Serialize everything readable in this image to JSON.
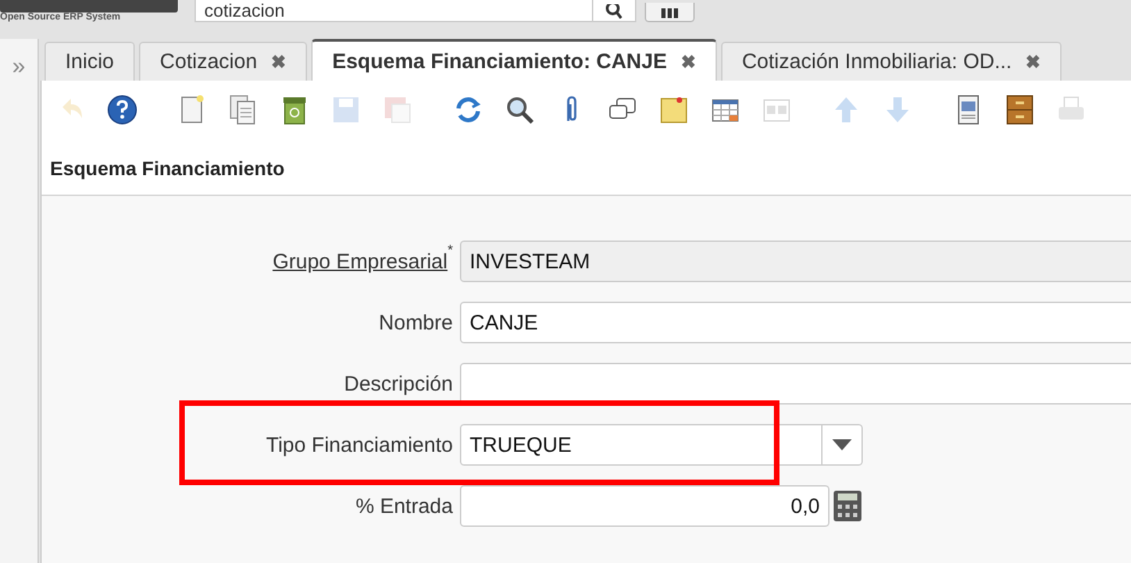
{
  "header": {
    "tagline": "Open Source ERP System",
    "search": {
      "value": "cotizacion"
    }
  },
  "sidebar": {
    "expand_glyph": "»"
  },
  "tabs": [
    {
      "label": "Inicio",
      "selected": false
    },
    {
      "label": "Cotizacion",
      "selected": false,
      "close": "✖"
    },
    {
      "label": "Esquema Financiamiento: CANJE",
      "selected": true,
      "close": "✖"
    },
    {
      "label": "Cotización Inmobiliaria: OD...",
      "selected": false,
      "close": "✖"
    }
  ],
  "toolbar": [
    {
      "kind": "undo",
      "disabled": true
    },
    {
      "kind": "help",
      "disabled": false
    },
    {
      "kind": "new",
      "disabled": false
    },
    {
      "kind": "copy",
      "disabled": false
    },
    {
      "kind": "delete",
      "disabled": false
    },
    {
      "kind": "save",
      "disabled": true
    },
    {
      "kind": "savenew",
      "disabled": true
    },
    {
      "kind": "refresh",
      "disabled": false
    },
    {
      "kind": "find",
      "disabled": false
    },
    {
      "kind": "attach",
      "disabled": false
    },
    {
      "kind": "chat",
      "disabled": false
    },
    {
      "kind": "note",
      "disabled": false
    },
    {
      "kind": "grid",
      "disabled": false
    },
    {
      "kind": "form",
      "disabled": true
    },
    {
      "kind": "up",
      "disabled": true
    },
    {
      "kind": "down",
      "disabled": true
    },
    {
      "kind": "report",
      "disabled": false
    },
    {
      "kind": "archive",
      "disabled": false
    },
    {
      "kind": "print",
      "disabled": true
    }
  ],
  "panel": {
    "title": "Esquema Financiamiento",
    "fields": [
      {
        "kind": "lookup",
        "label": "Grupo Empresarial",
        "required": true,
        "required_mark": "*",
        "value": "INVESTEAM",
        "highlighted": false
      },
      {
        "kind": "text",
        "label": "Nombre",
        "required": false,
        "value": "CANJE",
        "highlighted": false
      },
      {
        "kind": "text",
        "label": "Descripción",
        "required": false,
        "highlighted": false
      },
      {
        "kind": "select",
        "label": "Tipo Financiamiento",
        "required": false,
        "value": "TRUEQUE",
        "highlighted": true
      },
      {
        "kind": "number",
        "label": "% Entrada",
        "required": false,
        "value": "0,0",
        "highlighted": false
      }
    ]
  }
}
